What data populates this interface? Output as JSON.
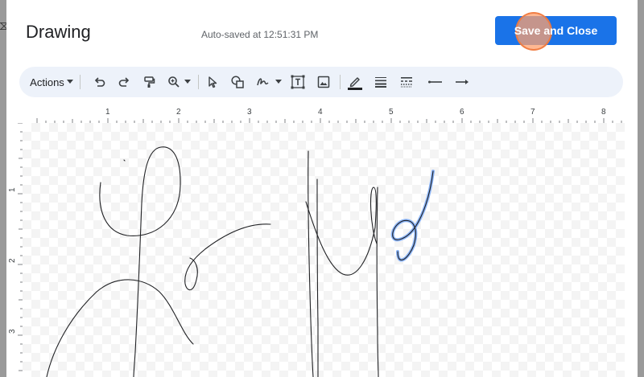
{
  "dialog": {
    "title": "Drawing",
    "autosave_status": "Auto-saved at 12:51:31 PM",
    "save_button_label": "Save and Close"
  },
  "toolbar": {
    "actions_label": "Actions",
    "tools": [
      "undo-icon",
      "redo-icon",
      "paint-format-icon",
      "zoom-icon",
      "select-icon",
      "shape-icon",
      "scribble-icon",
      "text-box-icon",
      "image-icon",
      "line-color-icon",
      "line-weight-icon",
      "line-dash-icon",
      "line-start-icon",
      "line-end-icon"
    ]
  },
  "ruler": {
    "horizontal_numbers": [
      "1",
      "2",
      "3",
      "4",
      "5",
      "6",
      "7",
      "8"
    ],
    "vertical_numbers": [
      "1",
      "2",
      "3"
    ]
  },
  "colors": {
    "accent": "#1a73e8",
    "toolbar_bg": "#edf2fa",
    "stroke": "#202124",
    "selected_stroke": "#8ab4f8"
  }
}
